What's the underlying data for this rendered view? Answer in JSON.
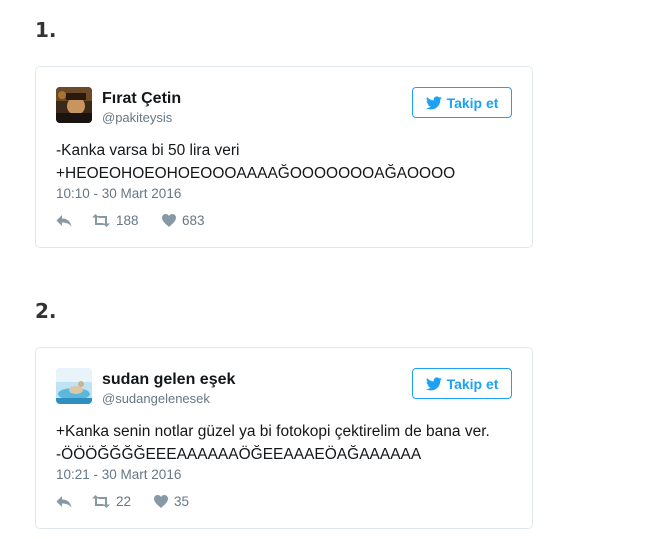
{
  "items": [
    {
      "number": "1.",
      "author": {
        "name": "Fırat Çetin",
        "handle": "@pakiteysis"
      },
      "follow_label": "Takip et",
      "text_lines": [
        "-Kanka varsa bi 50 lira veri",
        "+HEOEOHOEOHOEOOOAAAAĞOOOOOOOAĞAOOOO"
      ],
      "date": "10:10 - 30 Mart 2016",
      "retweets": "188",
      "likes": "683"
    },
    {
      "number": "2.",
      "author": {
        "name": "sudan gelen eşek",
        "handle": "@sudangelenesek"
      },
      "follow_label": "Takip et",
      "text_lines": [
        "+Kanka senin notlar güzel ya bi fotokopi çektirelim de bana ver.",
        "-ÖÖÖĞĞĞĞEEEAAAAAAÖĞEEAAAEÖAĞAAAAAA"
      ],
      "date": "10:21 - 30 Mart 2016",
      "retweets": "22",
      "likes": "35"
    }
  ],
  "colors": {
    "accent": "#1da1f2",
    "muted": "#657786",
    "border": "#e1e8ed"
  },
  "icons": [
    "twitter-bird-icon",
    "reply-icon",
    "retweet-icon",
    "heart-icon"
  ]
}
